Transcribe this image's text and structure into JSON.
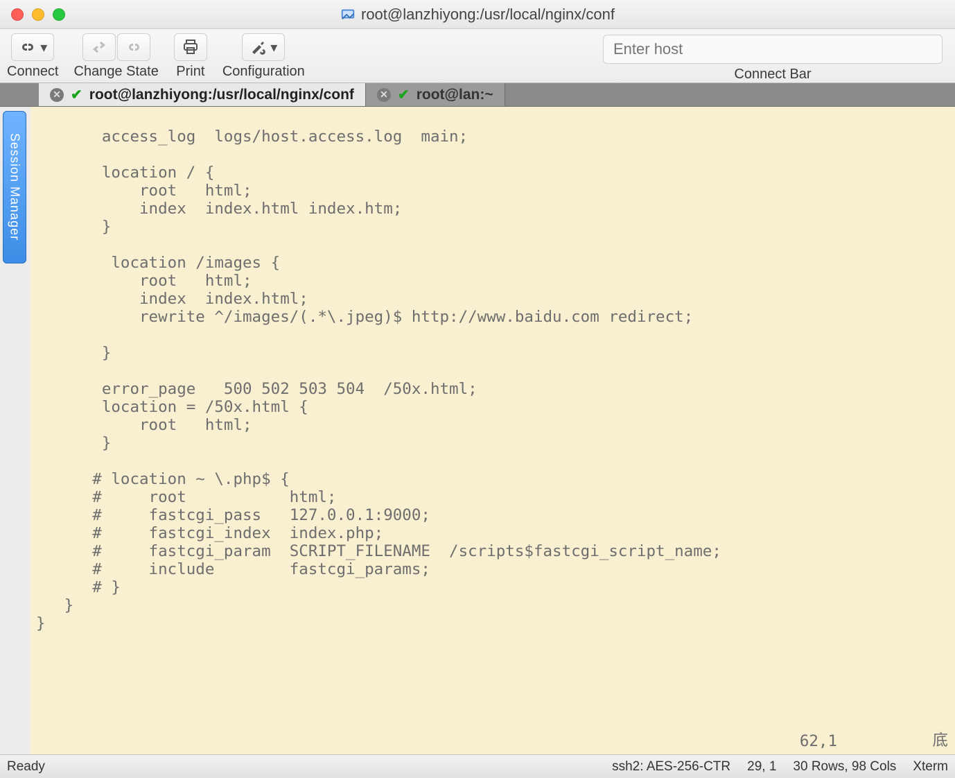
{
  "window": {
    "title": "root@lanzhiyong:/usr/local/nginx/conf"
  },
  "toolbar": {
    "connect_label": "Connect",
    "change_state_label": "Change State",
    "print_label": "Print",
    "configuration_label": "Configuration",
    "host_placeholder": "Enter host",
    "connectbar_label": "Connect Bar"
  },
  "tabs": [
    {
      "label": "root@lanzhiyong:/usr/local/nginx/conf",
      "active": true
    },
    {
      "label": "root@lan:~",
      "active": false
    }
  ],
  "session_manager": {
    "label": "Session Manager"
  },
  "terminal": {
    "content": "       access_log  logs/host.access.log  main;\n\n       location / {\n           root   html;\n           index  index.html index.htm;\n       }\n\n        location /images {\n           root   html;\n           index  index.html;\n           rewrite ^/images/(.*\\.jpeg)$ http://www.baidu.com redirect;\n\n       }\n\n       error_page   500 502 503 504  /50x.html;\n       location = /50x.html {\n           root   html;\n       }\n\n      # location ~ \\.php$ {\n      #     root           html;\n      #     fastcgi_pass   127.0.0.1:9000;\n      #     fastcgi_index  index.php;\n      #     fastcgi_param  SCRIPT_FILENAME  /scripts$fastcgi_script_name;\n      #     include        fastcgi_params;\n      # }\n   }\n}",
    "cursor_pos": "62,1",
    "scroll_pos": "底"
  },
  "statusbar": {
    "left": "Ready",
    "ssh": "ssh2: AES-256-CTR",
    "pos": "29, 1",
    "size": "30 Rows, 98 Cols",
    "term": "Xterm"
  }
}
